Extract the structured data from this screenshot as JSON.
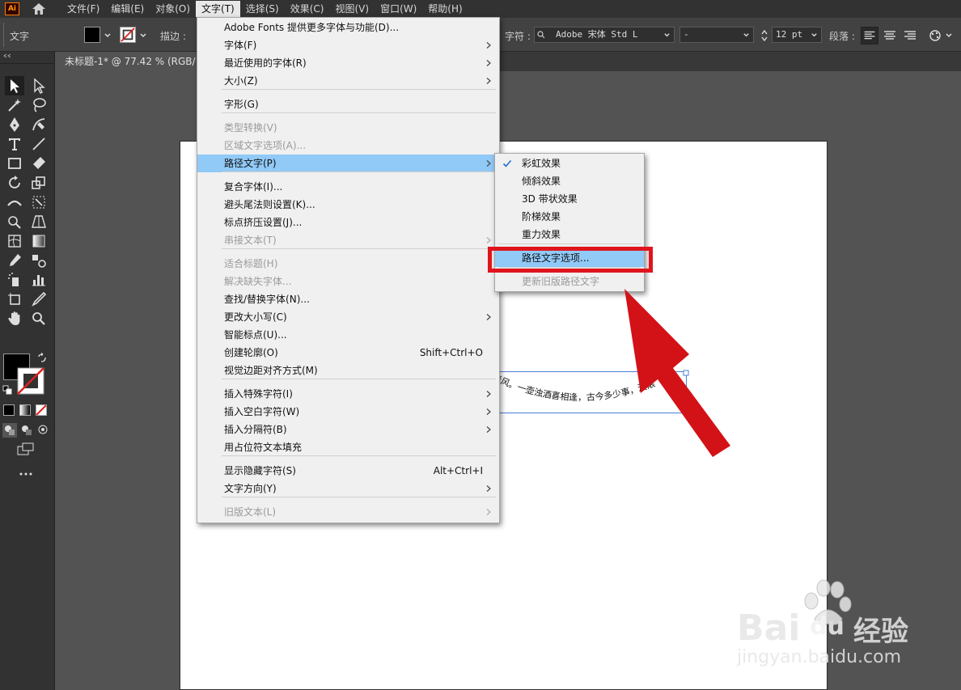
{
  "app": {
    "logo": "Ai"
  },
  "menubar": {
    "items": [
      "文件(F)",
      "编辑(E)",
      "对象(O)",
      "文字(T)",
      "选择(S)",
      "效果(C)",
      "视图(V)",
      "窗口(W)",
      "帮助(H)"
    ],
    "active_index": 3
  },
  "controlbar": {
    "mode_label": "文字",
    "stroke_label": "描边 :",
    "char_label": "字符 :",
    "font_name": "Adobe 宋体 Std L",
    "font_style": "-",
    "font_size": "12 pt",
    "para_label": "段落 :"
  },
  "document": {
    "tab_title": "未标题-1* @ 77.42 % (RGB/"
  },
  "canvas": {
    "path_text": "春风。一壶浊酒喜相逢，古今多少事，渡滚"
  },
  "type_menu": {
    "items": [
      {
        "label": "Adobe Fonts 提供更多字体与功能(D)...",
        "enabled": true
      },
      {
        "label": "字体(F)",
        "enabled": true,
        "submenu": true
      },
      {
        "label": "最近使用的字体(R)",
        "enabled": true,
        "submenu": true
      },
      {
        "label": "大小(Z)",
        "enabled": true,
        "submenu": true
      },
      {
        "label": "字形(G)",
        "enabled": true
      },
      {
        "label": "类型转换(V)",
        "enabled": false
      },
      {
        "label": "区域文字选项(A)...",
        "enabled": false
      },
      {
        "label": "路径文字(P)",
        "enabled": true,
        "submenu": true,
        "highlighted": true
      },
      {
        "label": "复合字体(I)...",
        "enabled": true
      },
      {
        "label": "避头尾法则设置(K)...",
        "enabled": true
      },
      {
        "label": "标点挤压设置(J)...",
        "enabled": true
      },
      {
        "label": "串接文本(T)",
        "enabled": false,
        "submenu": true
      },
      {
        "label": "适合标题(H)",
        "enabled": false
      },
      {
        "label": "解决缺失字体...",
        "enabled": false
      },
      {
        "label": "查找/替换字体(N)...",
        "enabled": true
      },
      {
        "label": "更改大小写(C)",
        "enabled": true,
        "submenu": true
      },
      {
        "label": "智能标点(U)...",
        "enabled": true
      },
      {
        "label": "创建轮廓(O)",
        "enabled": true,
        "shortcut": "Shift+Ctrl+O"
      },
      {
        "label": "视觉边距对齐方式(M)",
        "enabled": true
      },
      {
        "label": "插入特殊字符(I)",
        "enabled": true,
        "submenu": true
      },
      {
        "label": "插入空白字符(W)",
        "enabled": true,
        "submenu": true
      },
      {
        "label": "插入分隔符(B)",
        "enabled": true,
        "submenu": true
      },
      {
        "label": "用占位符文本填充",
        "enabled": true
      },
      {
        "label": "显示隐藏字符(S)",
        "enabled": true,
        "shortcut": "Alt+Ctrl+I"
      },
      {
        "label": "文字方向(Y)",
        "enabled": true,
        "submenu": true
      },
      {
        "label": "旧版文本(L)",
        "enabled": false,
        "submenu": true
      }
    ]
  },
  "path_type_submenu": {
    "items": [
      {
        "label": "彩虹效果",
        "checked": true
      },
      {
        "label": "倾斜效果"
      },
      {
        "label": "3D 带状效果"
      },
      {
        "label": "阶梯效果"
      },
      {
        "label": "重力效果"
      },
      {
        "label": "路径文字选项...",
        "highlighted": true
      },
      {
        "label": "更新旧版路径文字",
        "enabled": false
      }
    ]
  },
  "watermark": {
    "brand_left": "Bai",
    "brand_right": "du",
    "brand_cn": "经验",
    "url": "jingyan.baidu.com"
  },
  "colors": {
    "highlight": "#91c9f7",
    "annotation_red": "#e0141c",
    "menu_bg": "#f0f0f0"
  }
}
